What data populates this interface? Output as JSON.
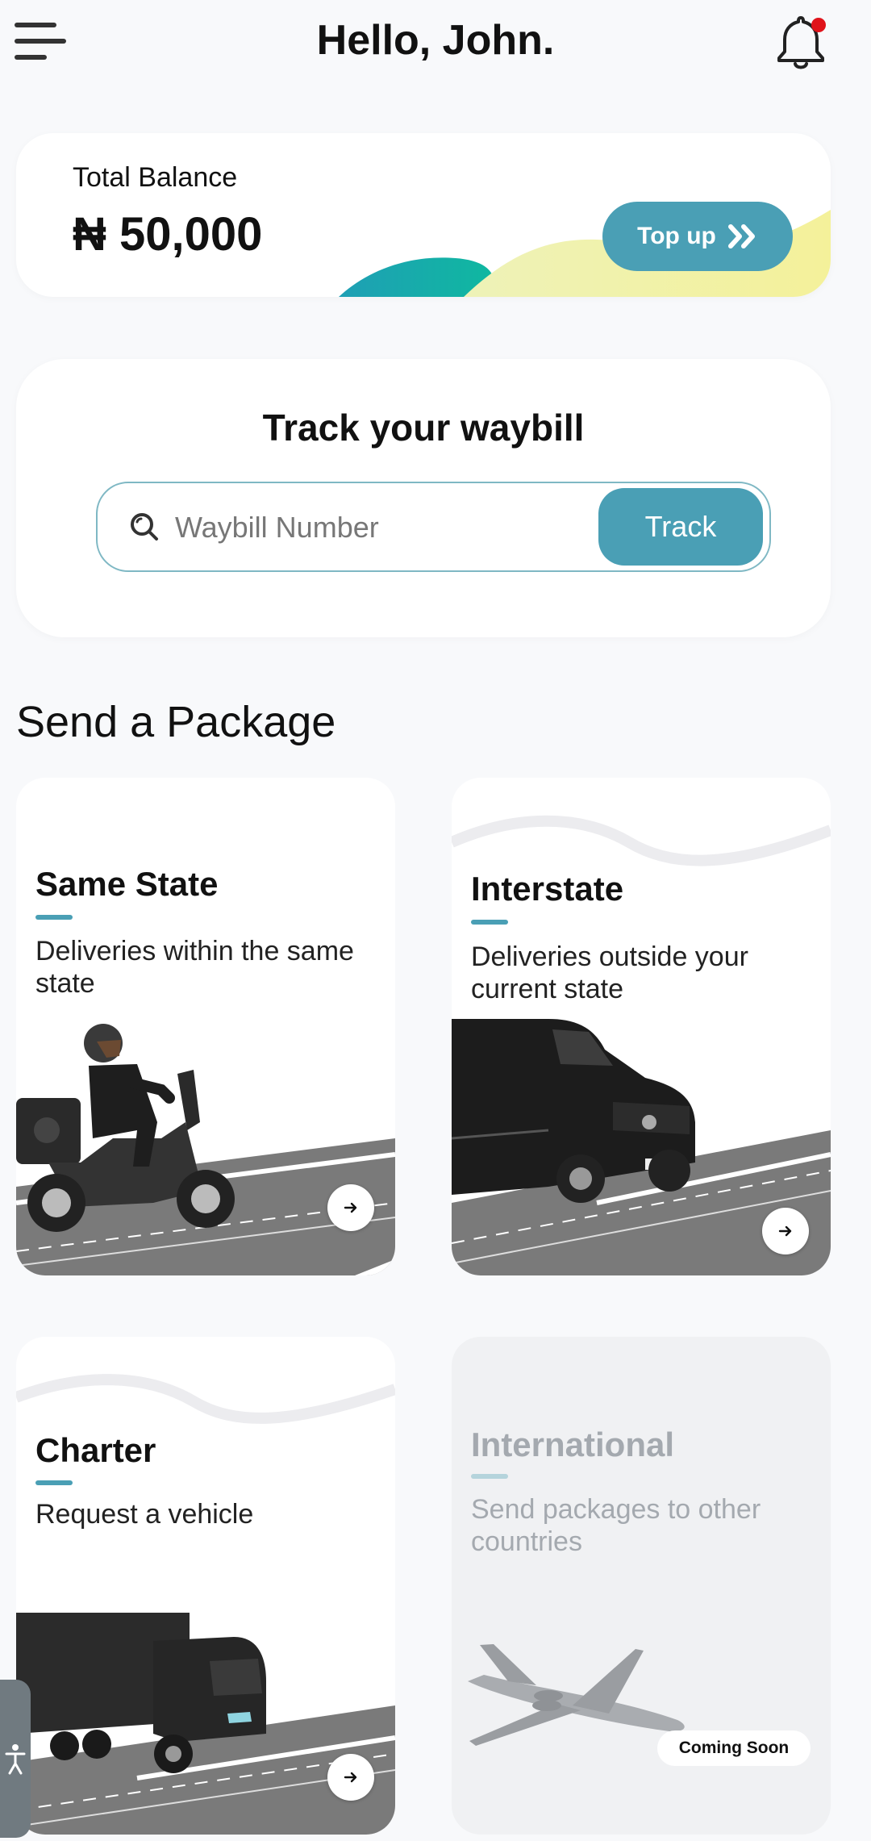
{
  "header": {
    "greeting": "Hello, John.",
    "menu_icon": "hamburger-menu-icon",
    "notification_icon": "bell-icon",
    "notification_dot_color": "#e0131a"
  },
  "balance": {
    "label": "Total Balance",
    "amount": "₦ 50,000",
    "topup_label": "Top up",
    "topup_icon": "double-chevron-right-icon"
  },
  "track": {
    "title": "Track your waybill",
    "placeholder": "Waybill Number",
    "value": "",
    "button_label": "Track",
    "search_icon": "search-icon"
  },
  "send_package": {
    "title": "Send a Package",
    "cards": [
      {
        "title": "Same State",
        "description": "Deliveries within the same state",
        "illustration": "scooter-rider",
        "enabled": true
      },
      {
        "title": "Interstate",
        "description": "Deliveries outside your current state",
        "illustration": "van",
        "enabled": true
      },
      {
        "title": "Charter",
        "description": "Request a vehicle",
        "illustration": "truck",
        "enabled": true
      },
      {
        "title": "International",
        "description": "Send packages to other countries",
        "illustration": "airplane",
        "enabled": false,
        "badge": "Coming Soon"
      }
    ]
  },
  "colors": {
    "accent": "#4a9fb5",
    "background": "#f8f9fb",
    "card": "#ffffff",
    "disabled_card": "#f0f1f3"
  },
  "accessibility_icon": "accessibility-icon"
}
